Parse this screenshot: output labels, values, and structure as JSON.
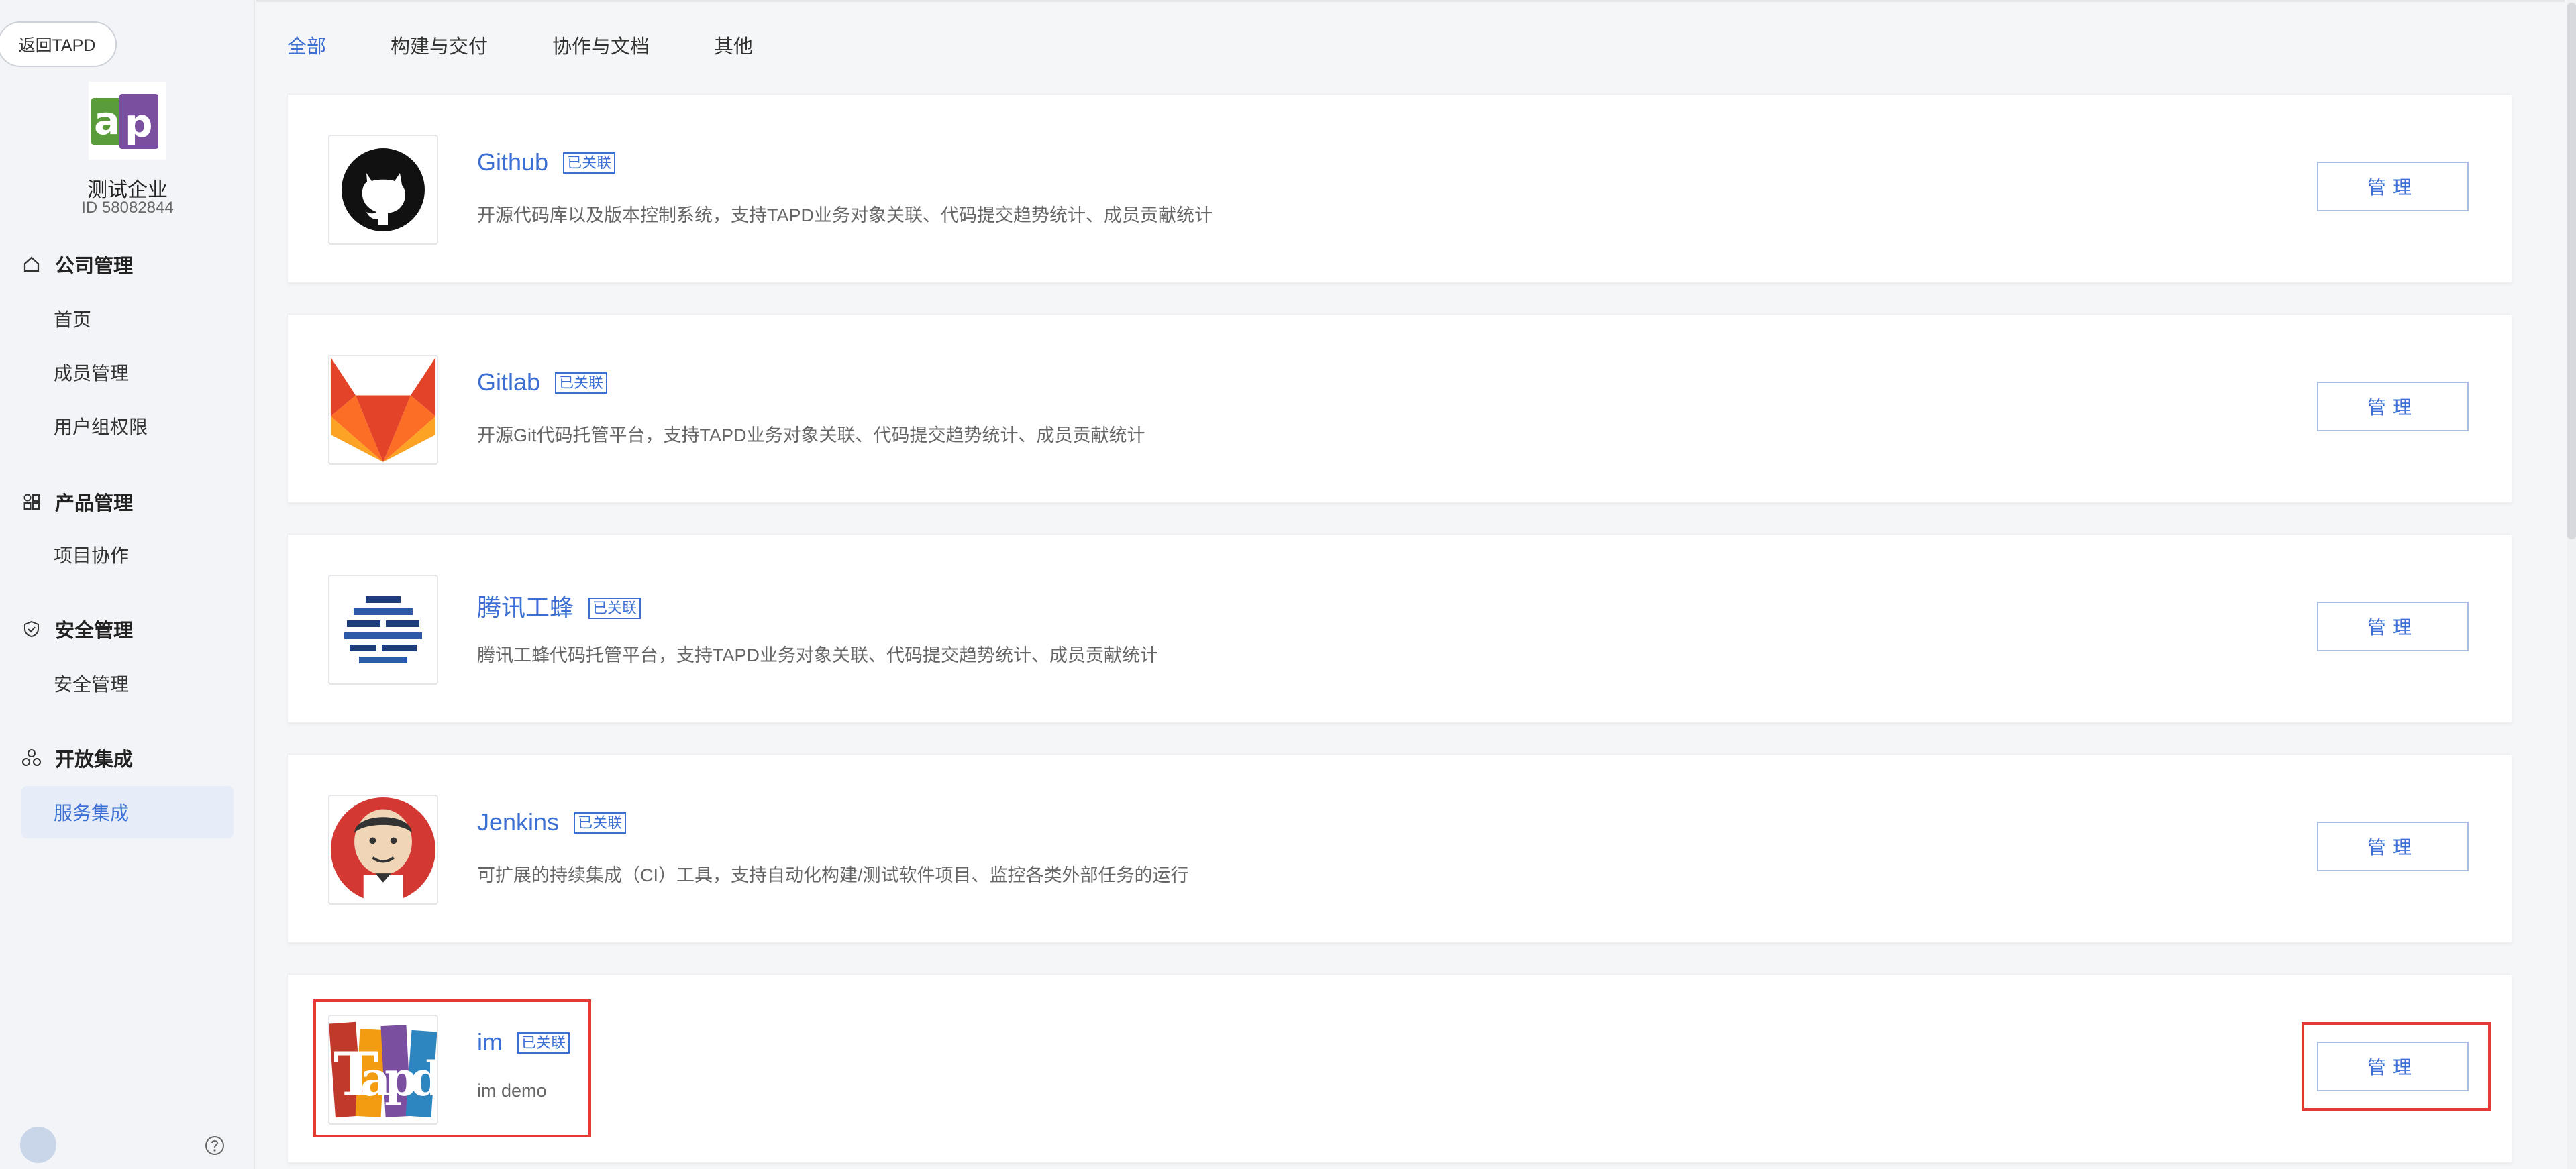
{
  "sidebar": {
    "back_label": "返回TAPD",
    "company_name": "测试企业",
    "company_id": "ID 58082844",
    "sections": [
      {
        "title": "公司管理",
        "icon": "home-icon",
        "items": [
          "首页",
          "成员管理",
          "用户组权限"
        ]
      },
      {
        "title": "产品管理",
        "icon": "grid-icon",
        "items": [
          "项目协作"
        ]
      },
      {
        "title": "安全管理",
        "icon": "shield-icon",
        "items": [
          "安全管理"
        ]
      },
      {
        "title": "开放集成",
        "icon": "integration-icon",
        "items": [
          "服务集成"
        ]
      }
    ],
    "active_item": "服务集成"
  },
  "tabs": [
    {
      "label": "全部",
      "active": true
    },
    {
      "label": "构建与交付",
      "active": false
    },
    {
      "label": "协作与文档",
      "active": false
    },
    {
      "label": "其他",
      "active": false
    }
  ],
  "integrations": [
    {
      "name": "Github",
      "badge": "已关联",
      "description": "开源代码库以及版本控制系统，支持TAPD业务对象关联、代码提交趋势统计、成员贡献统计",
      "button": "管理",
      "logo": "github-logo-icon"
    },
    {
      "name": "Gitlab",
      "badge": "已关联",
      "description": "开源Git代码托管平台，支持TAPD业务对象关联、代码提交趋势统计、成员贡献统计",
      "button": "管理",
      "logo": "gitlab-logo-icon"
    },
    {
      "name": "腾讯工蜂",
      "badge": "已关联",
      "description": "腾讯工蜂代码托管平台，支持TAPD业务对象关联、代码提交趋势统计、成员贡献统计",
      "button": "管理",
      "logo": "tencent-gongfeng-logo-icon"
    },
    {
      "name": "Jenkins",
      "badge": "已关联",
      "description": "可扩展的持续集成（CI）工具，支持自动化构建/测试软件项目、监控各类外部任务的运行",
      "button": "管理",
      "logo": "jenkins-logo-icon"
    },
    {
      "name": "im",
      "badge": "已关联",
      "description": "im demo",
      "button": "管理",
      "logo": "tapd-logo-icon"
    }
  ],
  "colors": {
    "accent": "#3b6fd4",
    "highlight": "#e53935"
  }
}
